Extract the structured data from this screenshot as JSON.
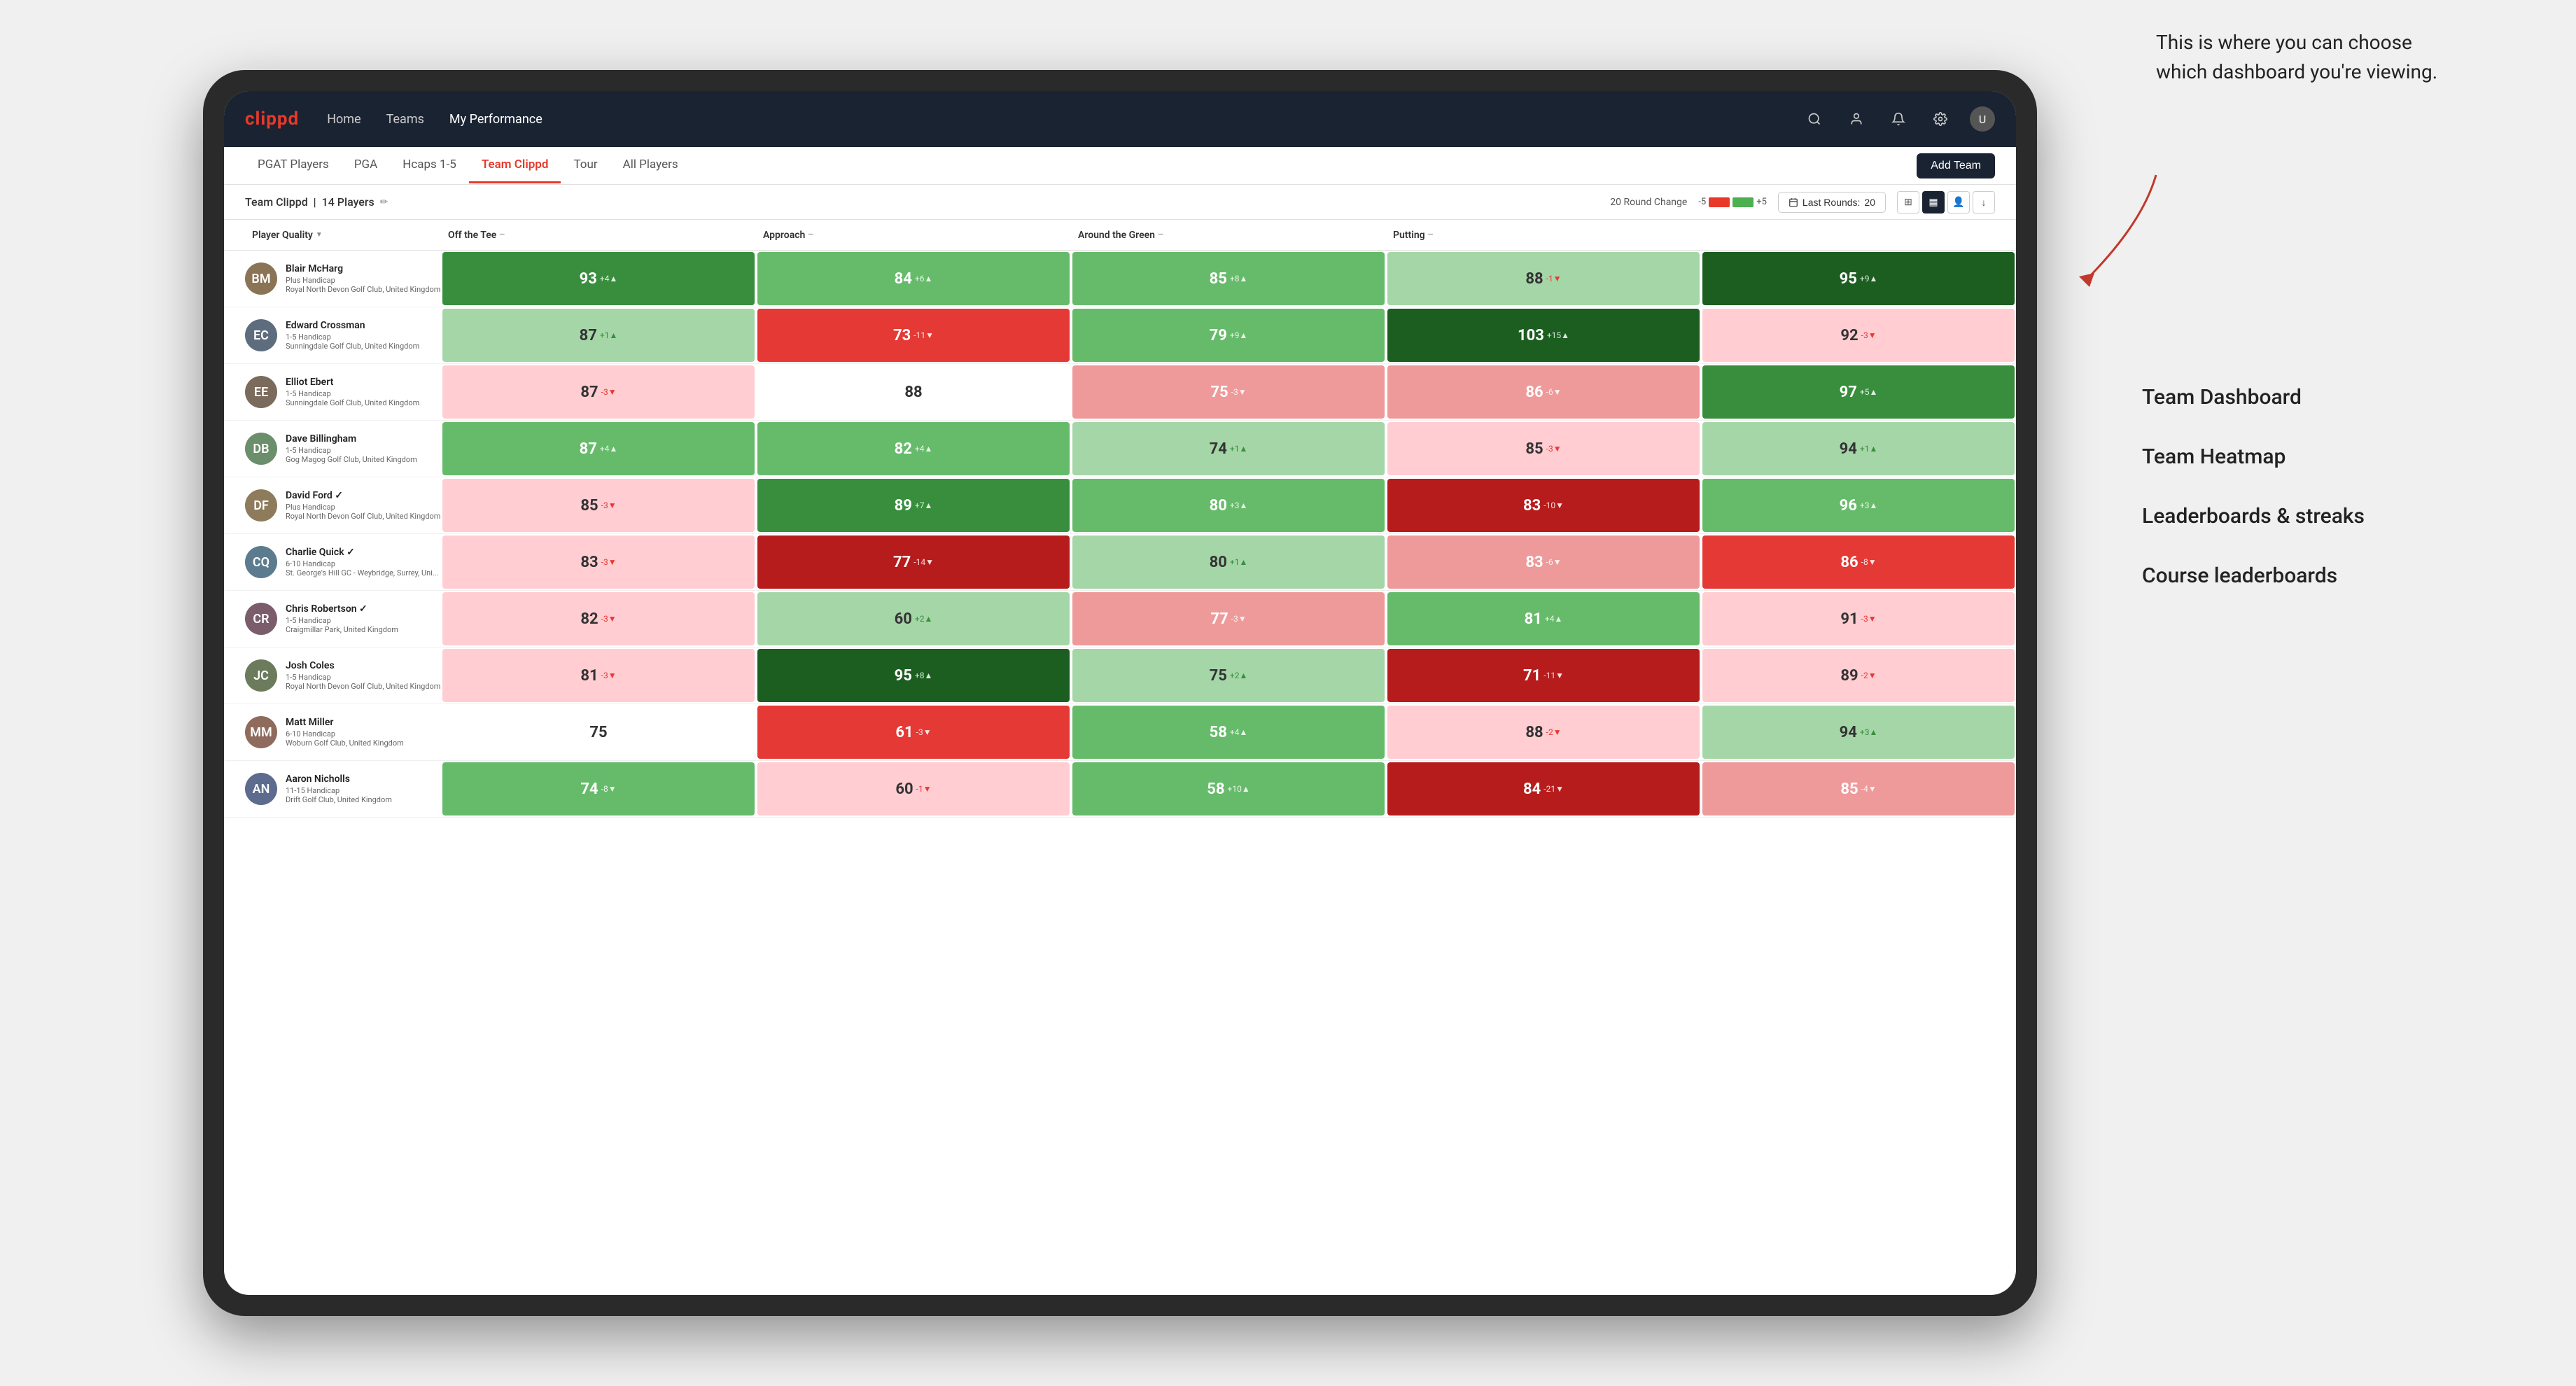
{
  "annotation": {
    "text": "This is where you can choose which dashboard you're viewing.",
    "labels": [
      "Team Dashboard",
      "Team Heatmap",
      "Leaderboards & streaks",
      "Course leaderboards"
    ]
  },
  "nav": {
    "logo": "clippd",
    "links": [
      "Home",
      "Teams",
      "My Performance"
    ],
    "active_link": "My Performance",
    "icons": [
      "search",
      "person",
      "bell",
      "settings",
      "avatar"
    ]
  },
  "sub_nav": {
    "links": [
      "PGAT Players",
      "PGA",
      "Hcaps 1-5",
      "Team Clippd",
      "Tour",
      "All Players"
    ],
    "active": "Team Clippd",
    "add_button": "Add Team"
  },
  "team_header": {
    "name": "Team Clippd",
    "player_count": "14 Players",
    "round_change_label": "20 Round Change",
    "scale_min": "-5",
    "scale_max": "+5",
    "last_rounds_label": "Last Rounds:",
    "last_rounds_value": "20"
  },
  "columns": {
    "player": "Player Quality",
    "tee": "Off the Tee",
    "approach": "Approach",
    "around_green": "Around the Green",
    "putting": "Putting"
  },
  "players": [
    {
      "name": "Blair McHarg",
      "handicap": "Plus Handicap",
      "club": "Royal North Devon Golf Club, United Kingdom",
      "avatar_color": "#8B7355",
      "avatar_initials": "BM",
      "player_quality": {
        "value": 93,
        "change": "+4",
        "dir": "up",
        "color": "green-mid"
      },
      "tee": {
        "value": 84,
        "change": "+6",
        "dir": "up",
        "color": "green-light"
      },
      "approach": {
        "value": 85,
        "change": "+8",
        "dir": "up",
        "color": "green-light"
      },
      "around_green": {
        "value": 88,
        "change": "-1",
        "dir": "down",
        "color": "green-pale"
      },
      "putting": {
        "value": 95,
        "change": "+9",
        "dir": "up",
        "color": "green-dark"
      }
    },
    {
      "name": "Edward Crossman",
      "handicap": "1-5 Handicap",
      "club": "Sunningdale Golf Club, United Kingdom",
      "avatar_color": "#5D6D7E",
      "avatar_initials": "EC",
      "player_quality": {
        "value": 87,
        "change": "+1",
        "dir": "up",
        "color": "green-pale"
      },
      "tee": {
        "value": 73,
        "change": "-11",
        "dir": "down",
        "color": "red-mid"
      },
      "approach": {
        "value": 79,
        "change": "+9",
        "dir": "up",
        "color": "green-light"
      },
      "around_green": {
        "value": 103,
        "change": "+15",
        "dir": "up",
        "color": "green-dark"
      },
      "putting": {
        "value": 92,
        "change": "-3",
        "dir": "down",
        "color": "red-pale"
      }
    },
    {
      "name": "Elliot Ebert",
      "handicap": "1-5 Handicap",
      "club": "Sunningdale Golf Club, United Kingdom",
      "avatar_color": "#7B6B5C",
      "avatar_initials": "EE",
      "player_quality": {
        "value": 87,
        "change": "-3",
        "dir": "down",
        "color": "red-pale"
      },
      "tee": {
        "value": 88,
        "change": "",
        "dir": "none",
        "color": "white-bg"
      },
      "approach": {
        "value": 75,
        "change": "-3",
        "dir": "down",
        "color": "red-light"
      },
      "around_green": {
        "value": 86,
        "change": "-6",
        "dir": "down",
        "color": "red-light"
      },
      "putting": {
        "value": 97,
        "change": "+5",
        "dir": "up",
        "color": "green-mid"
      }
    },
    {
      "name": "Dave Billingham",
      "handicap": "1-5 Handicap",
      "club": "Gog Magog Golf Club, United Kingdom",
      "avatar_color": "#6B8E6B",
      "avatar_initials": "DB",
      "player_quality": {
        "value": 87,
        "change": "+4",
        "dir": "up",
        "color": "green-light"
      },
      "tee": {
        "value": 82,
        "change": "+4",
        "dir": "up",
        "color": "green-light"
      },
      "approach": {
        "value": 74,
        "change": "+1",
        "dir": "up",
        "color": "green-pale"
      },
      "around_green": {
        "value": 85,
        "change": "-3",
        "dir": "down",
        "color": "red-pale"
      },
      "putting": {
        "value": 94,
        "change": "+1",
        "dir": "up",
        "color": "green-pale"
      }
    },
    {
      "name": "David Ford",
      "handicap": "Plus Handicap",
      "club": "Royal North Devon Golf Club, United Kingdom",
      "avatar_color": "#8E7B5C",
      "avatar_initials": "DF",
      "verified": true,
      "player_quality": {
        "value": 85,
        "change": "-3",
        "dir": "down",
        "color": "red-pale"
      },
      "tee": {
        "value": 89,
        "change": "+7",
        "dir": "up",
        "color": "green-mid"
      },
      "approach": {
        "value": 80,
        "change": "+3",
        "dir": "up",
        "color": "green-light"
      },
      "around_green": {
        "value": 83,
        "change": "-10",
        "dir": "down",
        "color": "red-dark"
      },
      "putting": {
        "value": 96,
        "change": "+3",
        "dir": "up",
        "color": "green-light"
      }
    },
    {
      "name": "Charlie Quick",
      "handicap": "6-10 Handicap",
      "club": "St. George's Hill GC - Weybridge, Surrey, Uni...",
      "avatar_color": "#5C7B8E",
      "avatar_initials": "CQ",
      "verified": true,
      "player_quality": {
        "value": 83,
        "change": "-3",
        "dir": "down",
        "color": "red-pale"
      },
      "tee": {
        "value": 77,
        "change": "-14",
        "dir": "down",
        "color": "red-dark"
      },
      "approach": {
        "value": 80,
        "change": "+1",
        "dir": "up",
        "color": "green-pale"
      },
      "around_green": {
        "value": 83,
        "change": "-6",
        "dir": "down",
        "color": "red-light"
      },
      "putting": {
        "value": 86,
        "change": "-8",
        "dir": "down",
        "color": "red-mid"
      }
    },
    {
      "name": "Chris Robertson",
      "handicap": "1-5 Handicap",
      "club": "Craigmillar Park, United Kingdom",
      "avatar_color": "#7B5C6B",
      "avatar_initials": "CR",
      "verified": true,
      "player_quality": {
        "value": 82,
        "change": "-3",
        "dir": "down",
        "color": "red-pale"
      },
      "tee": {
        "value": 60,
        "change": "+2",
        "dir": "up",
        "color": "green-pale"
      },
      "approach": {
        "value": 77,
        "change": "-3",
        "dir": "down",
        "color": "red-light"
      },
      "around_green": {
        "value": 81,
        "change": "+4",
        "dir": "up",
        "color": "green-light"
      },
      "putting": {
        "value": 91,
        "change": "-3",
        "dir": "down",
        "color": "red-pale"
      }
    },
    {
      "name": "Josh Coles",
      "handicap": "1-5 Handicap",
      "club": "Royal North Devon Golf Club, United Kingdom",
      "avatar_color": "#6B7B5C",
      "avatar_initials": "JC",
      "player_quality": {
        "value": 81,
        "change": "-3",
        "dir": "down",
        "color": "red-pale"
      },
      "tee": {
        "value": 95,
        "change": "+8",
        "dir": "up",
        "color": "green-dark"
      },
      "approach": {
        "value": 75,
        "change": "+2",
        "dir": "up",
        "color": "green-pale"
      },
      "around_green": {
        "value": 71,
        "change": "-11",
        "dir": "down",
        "color": "red-dark"
      },
      "putting": {
        "value": 89,
        "change": "-2",
        "dir": "down",
        "color": "red-pale"
      }
    },
    {
      "name": "Matt Miller",
      "handicap": "6-10 Handicap",
      "club": "Woburn Golf Club, United Kingdom",
      "avatar_color": "#8E6B5C",
      "avatar_initials": "MM",
      "player_quality": {
        "value": 75,
        "change": "",
        "dir": "none",
        "color": "white-bg"
      },
      "tee": {
        "value": 61,
        "change": "-3",
        "dir": "down",
        "color": "red-mid"
      },
      "approach": {
        "value": 58,
        "change": "+4",
        "dir": "up",
        "color": "green-light"
      },
      "around_green": {
        "value": 88,
        "change": "-2",
        "dir": "down",
        "color": "red-pale"
      },
      "putting": {
        "value": 94,
        "change": "+3",
        "dir": "up",
        "color": "green-pale"
      }
    },
    {
      "name": "Aaron Nicholls",
      "handicap": "11-15 Handicap",
      "club": "Drift Golf Club, United Kingdom",
      "avatar_color": "#5C6B8E",
      "avatar_initials": "AN",
      "player_quality": {
        "value": 74,
        "change": "-8",
        "dir": "down",
        "color": "green-light"
      },
      "tee": {
        "value": 60,
        "change": "-1",
        "dir": "down",
        "color": "red-pale"
      },
      "approach": {
        "value": 58,
        "change": "+10",
        "dir": "up",
        "color": "green-light"
      },
      "around_green": {
        "value": 84,
        "change": "-21",
        "dir": "down",
        "color": "red-dark"
      },
      "putting": {
        "value": 85,
        "change": "-4",
        "dir": "down",
        "color": "red-light"
      }
    }
  ]
}
